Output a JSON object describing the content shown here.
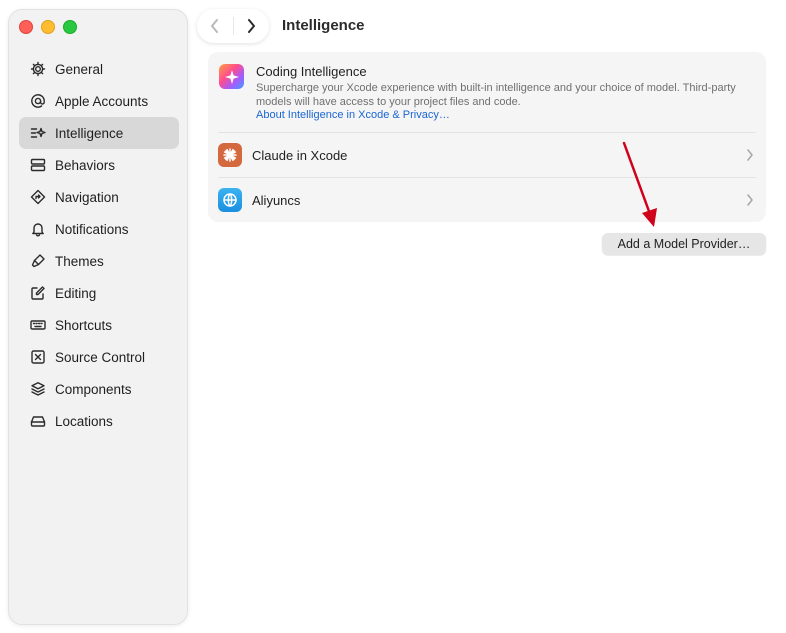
{
  "window": {
    "title": "Intelligence",
    "traffic_lights": [
      "close",
      "minimize",
      "zoom"
    ]
  },
  "sidebar": {
    "items": [
      {
        "label": "General",
        "icon": "gear-icon"
      },
      {
        "label": "Apple Accounts",
        "icon": "at-icon"
      },
      {
        "label": "Intelligence",
        "icon": "sparkle-lines-icon",
        "selected": true
      },
      {
        "label": "Behaviors",
        "icon": "behaviors-icon"
      },
      {
        "label": "Navigation",
        "icon": "navigation-diamond-icon"
      },
      {
        "label": "Notifications",
        "icon": "bell-icon"
      },
      {
        "label": "Themes",
        "icon": "paintbrush-icon"
      },
      {
        "label": "Editing",
        "icon": "edit-square-icon"
      },
      {
        "label": "Shortcuts",
        "icon": "keyboard-icon"
      },
      {
        "label": "Source Control",
        "icon": "source-control-icon"
      },
      {
        "label": "Components",
        "icon": "stack-icon"
      },
      {
        "label": "Locations",
        "icon": "drive-icon"
      }
    ]
  },
  "main": {
    "coding_intelligence": {
      "title": "Coding Intelligence",
      "description": "Supercharge your Xcode experience with built-in intelligence and your choice of model. Third-party models will have access to your project files and code.",
      "link": "About Intelligence in Xcode & Privacy…",
      "icon": "sparkle-icon"
    },
    "providers": [
      {
        "label": "Claude in Xcode",
        "icon": "claude-icon"
      },
      {
        "label": "Aliyuncs",
        "icon": "globe-icon"
      }
    ],
    "add_button": "Add a Model Provider…"
  },
  "colors": {
    "accent_link": "#1a66d2",
    "annotation_arrow": "#d0021b",
    "selected_bg": "#d8d8d8"
  }
}
